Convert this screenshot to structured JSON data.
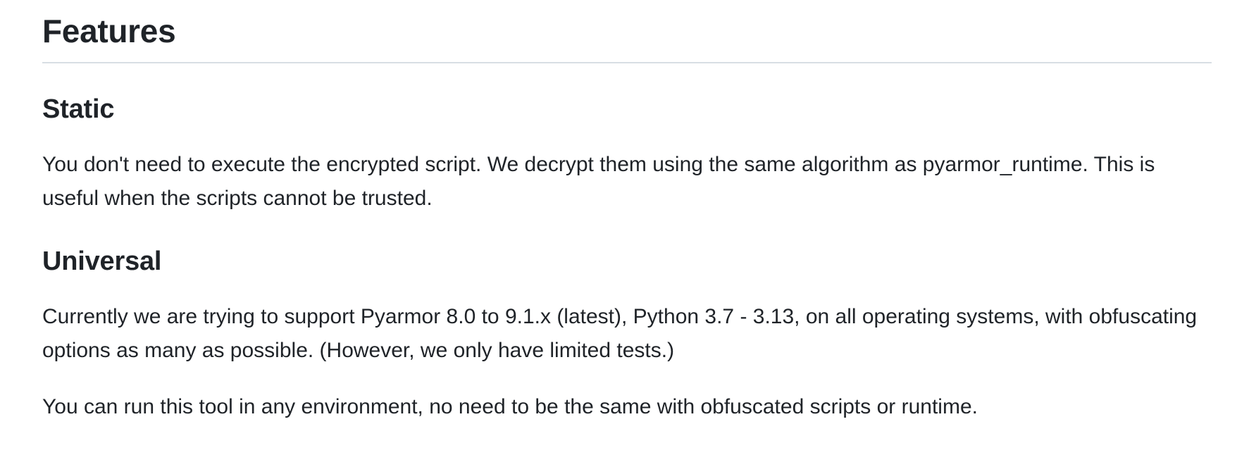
{
  "doc": {
    "title": "Features",
    "sections": [
      {
        "heading": "Static",
        "paragraphs": [
          "You don't need to execute the encrypted script. We decrypt them using the same algorithm as pyarmor_runtime. This is useful when the scripts cannot be trusted."
        ]
      },
      {
        "heading": "Universal",
        "paragraphs": [
          "Currently we are trying to support Pyarmor 8.0 to 9.1.x (latest), Python 3.7 - 3.13, on all operating systems, with obfuscating options as many as possible. (However, we only have limited tests.)",
          "You can run this tool in any environment, no need to be the same with obfuscated scripts or runtime."
        ]
      }
    ]
  }
}
